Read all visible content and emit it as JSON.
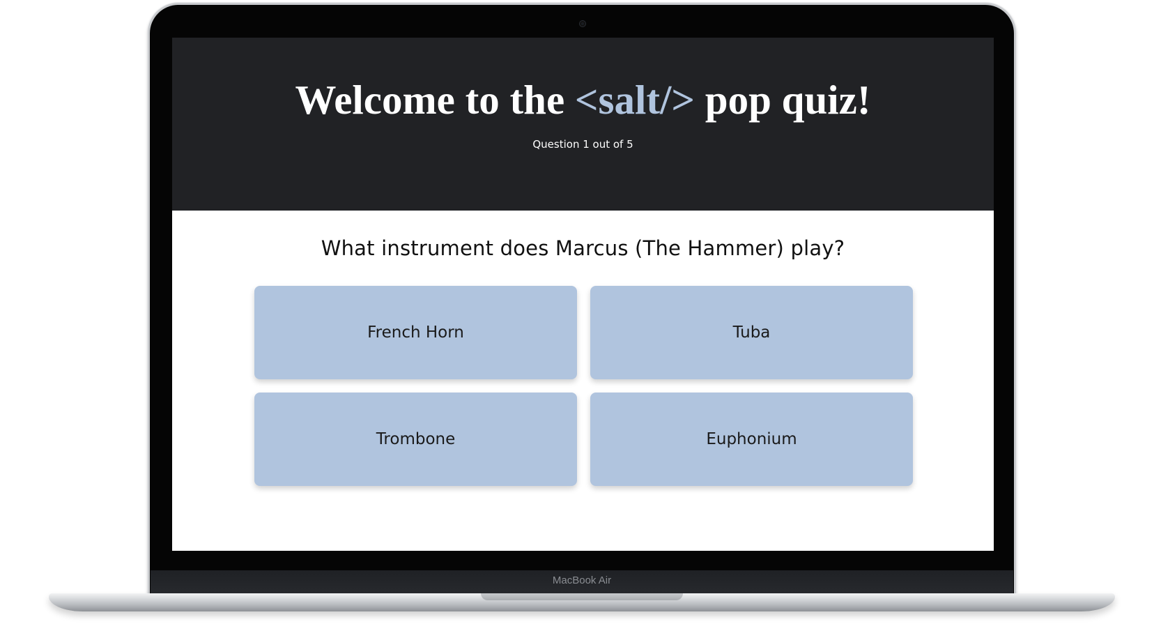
{
  "device": {
    "model_label": "MacBook Air"
  },
  "header": {
    "title_prefix": "Welcome to the ",
    "title_brand": "<salt/>",
    "title_suffix": " pop quiz!",
    "progress_text": "Question 1 out of 5"
  },
  "quiz": {
    "question": "What instrument does Marcus (The Hammer) play?",
    "answers": [
      {
        "label": "French Horn"
      },
      {
        "label": "Tuba"
      },
      {
        "label": "Trombone"
      },
      {
        "label": "Euphonium"
      }
    ]
  },
  "colors": {
    "header_background": "#212225",
    "brand_accent": "#b0c4de",
    "answer_button": "#b0c4de"
  }
}
